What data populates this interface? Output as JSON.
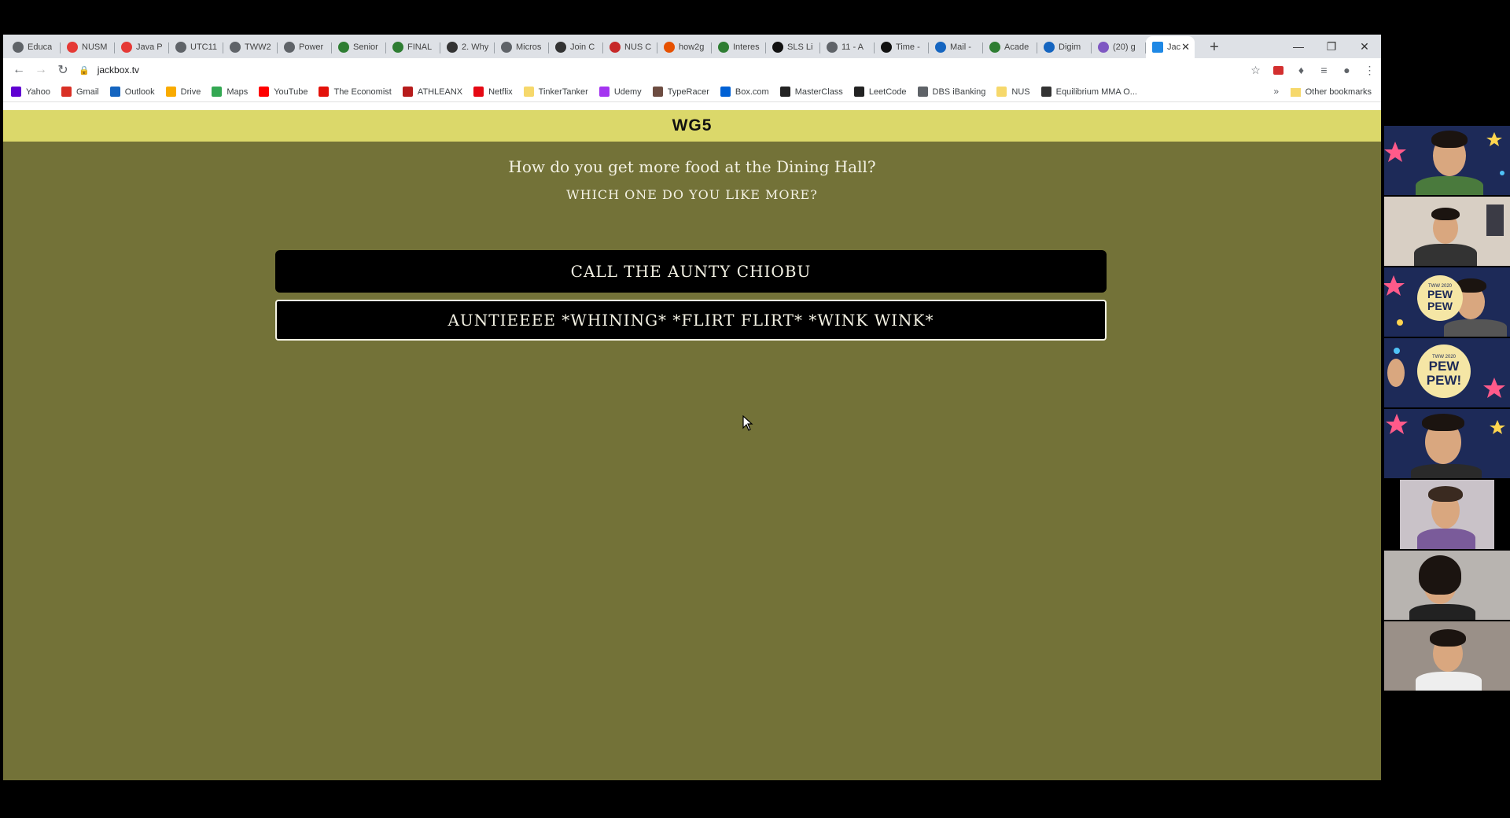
{
  "browser": {
    "tabs": [
      {
        "label": "Educa",
        "icon": "globe-icon",
        "color": "#5f6368"
      },
      {
        "label": "NUSM",
        "icon": "nus-mods-icon",
        "color": "#e53935"
      },
      {
        "label": "Java P",
        "icon": "coursemology-icon",
        "color": "#e53935"
      },
      {
        "label": "UTC11",
        "icon": "globe-icon",
        "color": "#5f6368"
      },
      {
        "label": "TWW2",
        "icon": "globe-icon",
        "color": "#5f6368"
      },
      {
        "label": "Power",
        "icon": "globe-icon",
        "color": "#5f6368"
      },
      {
        "label": "Senior",
        "icon": "luminus-icon",
        "color": "#2e7d32"
      },
      {
        "label": "FINAL",
        "icon": "luminus-icon",
        "color": "#2e7d32"
      },
      {
        "label": "2. Why",
        "icon": "book-icon",
        "color": "#333333"
      },
      {
        "label": "Micros",
        "icon": "globe-icon",
        "color": "#5f6368"
      },
      {
        "label": "Join C",
        "icon": "page-icon",
        "color": "#333333"
      },
      {
        "label": "NUS C",
        "icon": "shield-icon",
        "color": "#c62828"
      },
      {
        "label": "how2g",
        "icon": "bookmark-icon",
        "color": "#e65100"
      },
      {
        "label": "Interes",
        "icon": "luminus-icon",
        "color": "#2e7d32"
      },
      {
        "label": "SLS Li",
        "icon": "sls-icon",
        "color": "#111111"
      },
      {
        "label": "11 - A",
        "icon": "globe-icon",
        "color": "#5f6368"
      },
      {
        "label": "Time -",
        "icon": "wikipedia-icon",
        "color": "#111111"
      },
      {
        "label": "Mail -",
        "icon": "outlook-icon",
        "color": "#1565c0"
      },
      {
        "label": "Acade",
        "icon": "luminus-icon",
        "color": "#2e7d32"
      },
      {
        "label": "Digim",
        "icon": "digimap-icon",
        "color": "#1565c0"
      },
      {
        "label": "(20) g",
        "icon": "twitch-icon",
        "color": "#7e57c2"
      }
    ],
    "active_tab": {
      "label": "Jac",
      "icon": "jackbox-icon",
      "color": "#1e88e5"
    },
    "url": "jackbox.tv",
    "bookmarks": [
      {
        "label": "Yahoo",
        "icon": "yahoo-icon",
        "color": "#6001d2"
      },
      {
        "label": "Gmail",
        "icon": "gmail-icon",
        "color": "#d93025"
      },
      {
        "label": "Outlook",
        "icon": "outlook-icon",
        "color": "#1565c0"
      },
      {
        "label": "Drive",
        "icon": "drive-icon",
        "color": "#f9ab00"
      },
      {
        "label": "Maps",
        "icon": "maps-icon",
        "color": "#34a853"
      },
      {
        "label": "YouTube",
        "icon": "youtube-icon",
        "color": "#ff0000"
      },
      {
        "label": "The Economist",
        "icon": "economist-icon",
        "color": "#e3120b"
      },
      {
        "label": "ATHLEANX",
        "icon": "athleanx-icon",
        "color": "#b71c1c"
      },
      {
        "label": "Netflix",
        "icon": "netflix-icon",
        "color": "#e50914"
      },
      {
        "label": "TinkerTanker",
        "icon": "folder-icon",
        "color": "#f6d86b"
      },
      {
        "label": "Udemy",
        "icon": "udemy-icon",
        "color": "#a435f0"
      },
      {
        "label": "TypeRacer",
        "icon": "typeracer-icon",
        "color": "#6d4c41"
      },
      {
        "label": "Box.com",
        "icon": "box-icon",
        "color": "#0061d5"
      },
      {
        "label": "MasterClass",
        "icon": "masterclass-icon",
        "color": "#222222"
      },
      {
        "label": "LeetCode",
        "icon": "leetcode-icon",
        "color": "#222222"
      },
      {
        "label": "DBS iBanking",
        "icon": "globe-icon",
        "color": "#5f6368"
      },
      {
        "label": "NUS",
        "icon": "folder-icon",
        "color": "#f6d86b"
      },
      {
        "label": "Equilibrium MMA O...",
        "icon": "circle-icon",
        "color": "#333333"
      }
    ],
    "other_bookmarks": "Other bookmarks"
  },
  "game": {
    "room_name": "WG5",
    "prompt": "How do you get more food at the Dining Hall?",
    "instruction": "WHICH ONE DO YOU LIKE MORE?",
    "choices": [
      "CALL THE AUNTY CHIOBU",
      "AUNTIEEEE *WHINING* *FLIRT FLIRT* *WINK WINK*"
    ],
    "accent_color": "#dbd86a",
    "background_color": "#737238"
  },
  "participants": {
    "badge_small": "TWW 2020",
    "badge_text": "PEW PEW!",
    "badge_partial": "PEW PEW"
  }
}
